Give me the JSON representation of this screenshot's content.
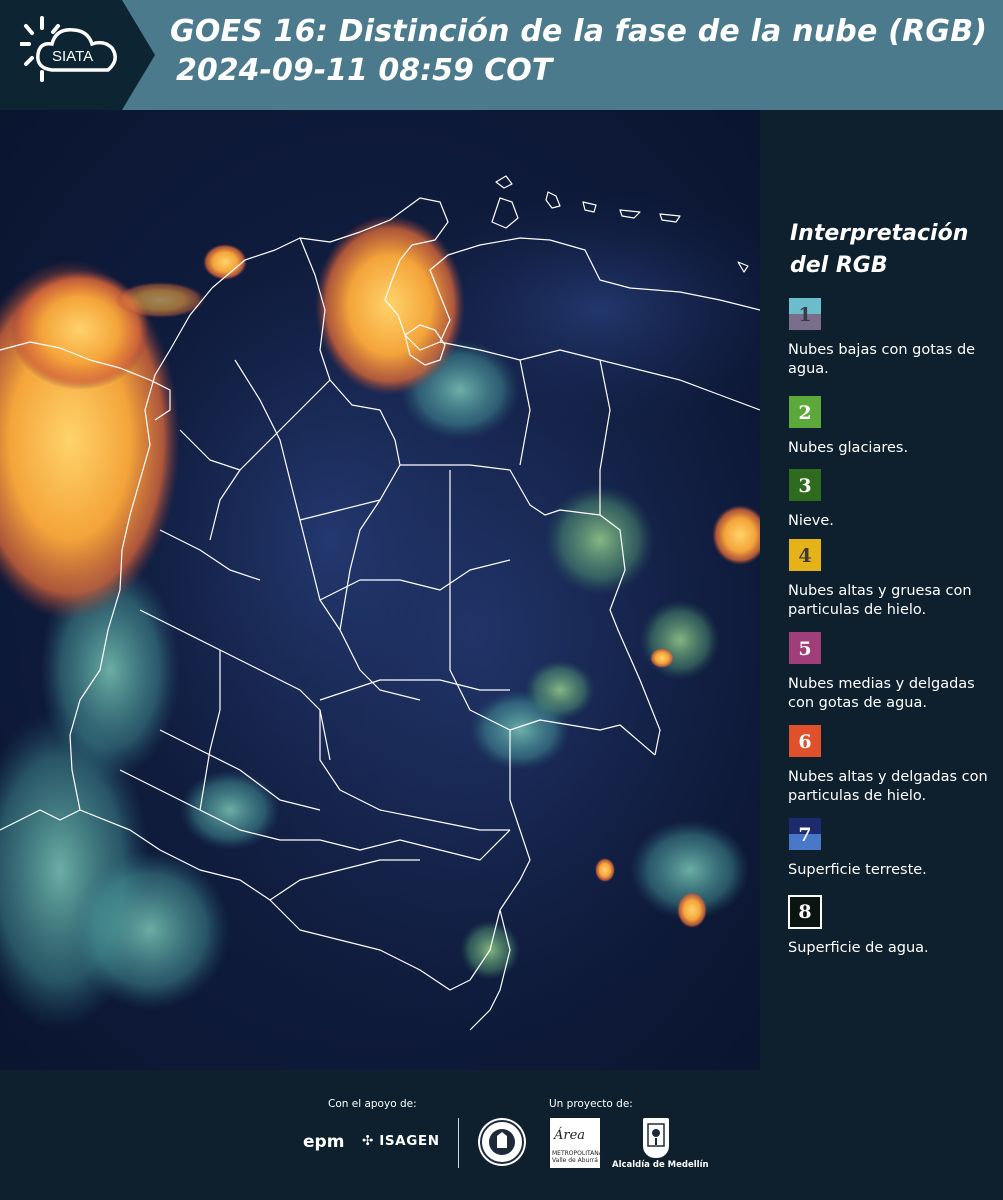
{
  "header": {
    "logo_text": "SIATA",
    "title_line1": "GOES 16: Distinción de la fase de la nube (RGB)",
    "title_line2": "2024-09-11 08:59 COT"
  },
  "legend": {
    "title": "Interpretación del RGB",
    "items": [
      {
        "num": "1",
        "label": "Nubes bajas con gotas de agua.",
        "color_top": "#6cbccc",
        "color_bottom": "#7a6e8c",
        "num_color": "#3a3a4a"
      },
      {
        "num": "2",
        "label": "Nubes glaciares.",
        "color_top": "#5da83a",
        "color_bottom": "#5da83a",
        "num_color": "#ffffff"
      },
      {
        "num": "3",
        "label": "Nieve.",
        "color_top": "#2f6b1f",
        "color_bottom": "#2f6b1f",
        "num_color": "#ffffff"
      },
      {
        "num": "4",
        "label": "Nubes altas y gruesa con particulas de hielo.",
        "color_top": "#e6b21a",
        "color_bottom": "#e6b21a",
        "num_color": "#3a3a3a"
      },
      {
        "num": "5",
        "label": "Nubes medias y delgadas con gotas de agua.",
        "color_top": "#a03e7a",
        "color_bottom": "#a03e7a",
        "num_color": "#ffffff"
      },
      {
        "num": "6",
        "label": "Nubes altas y delgadas con particulas de hielo.",
        "color_top": "#e0502a",
        "color_bottom": "#e0502a",
        "num_color": "#ffffff"
      },
      {
        "num": "7",
        "label": "Superficie terreste.",
        "color_top": "#1e2a6e",
        "color_bottom": "#4a78c8",
        "num_color": "#ffffff"
      },
      {
        "num": "8",
        "label": "Superficie de agua.",
        "color_top": "#0a1410",
        "color_bottom": "#0a1410",
        "num_color": "#ffffff"
      }
    ]
  },
  "footer": {
    "support_label": "Con el apoyo de:",
    "project_label": "Un proyecto de:",
    "epm": "epm",
    "isagen": "ISAGEN",
    "area_logo": "Área",
    "area_sub": "METROPOLITANA Valle de Aburrá",
    "alcaldia": "Alcaldía de Medellín"
  },
  "colors": {
    "header_bg": "#4a7a8c",
    "logo_bg": "#0d2433",
    "panel_bg": "#0e202d",
    "cloud_thick_ice": "#f5a623",
    "low_water_cloud": "#5fb8b0",
    "land_surface": "#1c2a5a",
    "border_lines": "#ffffff"
  }
}
